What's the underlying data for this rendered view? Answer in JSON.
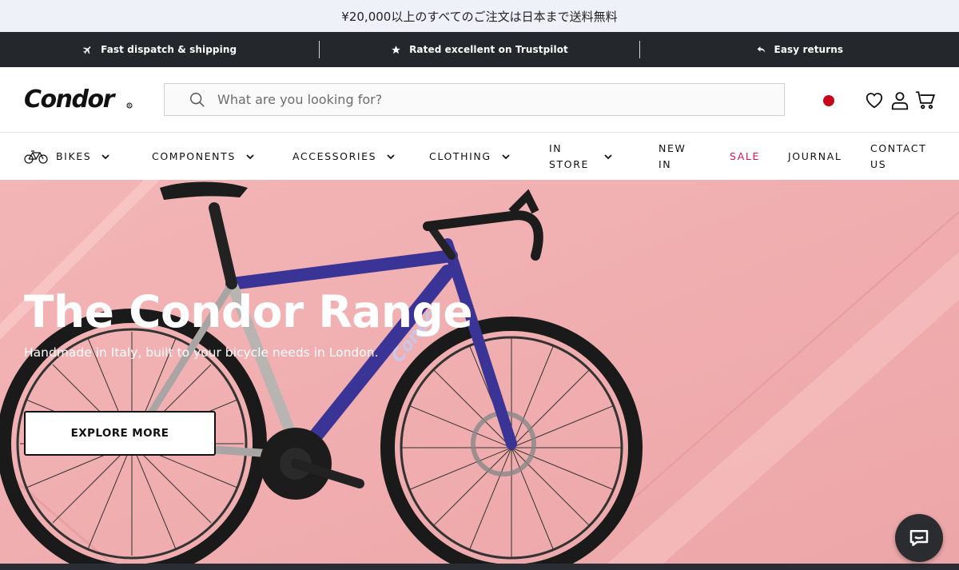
{
  "promo": {
    "text": "¥20,000以上のすべてのご注文は日本まで送料無料"
  },
  "usp": [
    {
      "icon": "plane-icon",
      "label": "Fast dispatch & shipping"
    },
    {
      "icon": "star-icon",
      "label": "Rated excellent on Trustpilot"
    },
    {
      "icon": "return-arrow-icon",
      "label": "Easy returns"
    }
  ],
  "header": {
    "logo_text": "Condor",
    "search_placeholder": "What are you looking for?",
    "flag_color": "#c4071b",
    "icons": [
      "wishlist-heart-icon",
      "account-user-icon",
      "cart-icon"
    ]
  },
  "nav": {
    "items": [
      {
        "label": "BIKES",
        "dropdown": true,
        "icon": "bicycle-icon"
      },
      {
        "label": "COMPONENTS",
        "dropdown": true
      },
      {
        "label": "ACCESSORIES",
        "dropdown": true
      },
      {
        "label": "CLOTHING",
        "dropdown": true
      },
      {
        "label": "IN STORE",
        "dropdown": true
      },
      {
        "label": "NEW IN",
        "dropdown": false
      },
      {
        "label": "SALE",
        "dropdown": false,
        "color": "#d4145a"
      },
      {
        "label": "JOURNAL",
        "dropdown": false
      },
      {
        "label": "CONTACT US",
        "dropdown": false
      }
    ]
  },
  "hero": {
    "title": "The Condor Range",
    "subtitle": "Handmade in Italy, built to your bicycle needs in London.",
    "cta_label": "EXPLORE MORE",
    "background_color": "#f0aeb0"
  },
  "chat": {
    "icon": "chat-bubble-icon"
  }
}
